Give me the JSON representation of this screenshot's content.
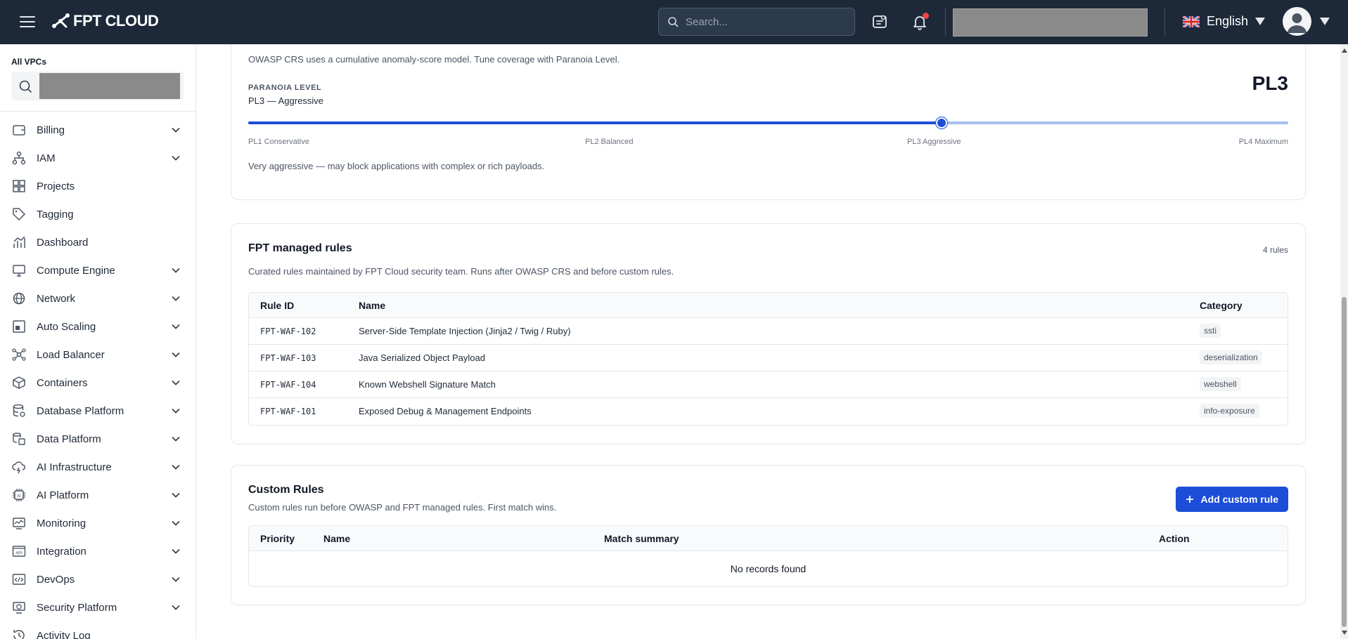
{
  "topbar": {
    "brand": "FPT CLOUD",
    "search_placeholder": "Search...",
    "language": "English"
  },
  "sidebar": {
    "vpc_label": "All VPCs",
    "items": [
      {
        "label": "Billing",
        "icon": "wallet-icon",
        "expandable": true
      },
      {
        "label": "IAM",
        "icon": "hierarchy-icon",
        "expandable": true
      },
      {
        "label": "Projects",
        "icon": "grid-plus-icon",
        "expandable": false
      },
      {
        "label": "Tagging",
        "icon": "tag-icon",
        "expandable": false
      },
      {
        "label": "Dashboard",
        "icon": "chart-icon",
        "expandable": false
      },
      {
        "label": "Compute Engine",
        "icon": "monitor-icon",
        "expandable": true
      },
      {
        "label": "Network",
        "icon": "globe-icon",
        "expandable": true
      },
      {
        "label": "Auto Scaling",
        "icon": "scaling-icon",
        "expandable": true
      },
      {
        "label": "Load Balancer",
        "icon": "load-balancer-icon",
        "expandable": true
      },
      {
        "label": "Containers",
        "icon": "cube-icon",
        "expandable": true
      },
      {
        "label": "Database Platform",
        "icon": "database-icon",
        "expandable": true
      },
      {
        "label": "Data Platform",
        "icon": "data-platform-icon",
        "expandable": true
      },
      {
        "label": "AI Infrastructure",
        "icon": "cloud-bolt-icon",
        "expandable": true
      },
      {
        "label": "AI Platform",
        "icon": "ai-chip-icon",
        "expandable": true
      },
      {
        "label": "Monitoring",
        "icon": "monitoring-icon",
        "expandable": true
      },
      {
        "label": "Integration",
        "icon": "api-icon",
        "expandable": true
      },
      {
        "label": "DevOps",
        "icon": "code-icon",
        "expandable": true
      },
      {
        "label": "Security Platform",
        "icon": "shield-icon",
        "expandable": true
      },
      {
        "label": "Activity Log",
        "icon": "history-icon",
        "expandable": false
      }
    ]
  },
  "owasp": {
    "description": "OWASP CRS uses a cumulative anomaly-score model. Tune coverage with Paranoia Level.",
    "paranoia_label": "PARANOIA LEVEL",
    "paranoia_value": "PL3 — Aggressive",
    "level_badge": "PL3",
    "slider_fraction": 0.667,
    "ticks": [
      "PL1 Conservative",
      "PL2 Balanced",
      "PL3 Aggressive",
      "PL4 Maximum"
    ],
    "note": "Very aggressive — may block applications with complex or rich payloads."
  },
  "managed": {
    "title": "FPT managed rules",
    "count": "4 rules",
    "description": "Curated rules maintained by FPT Cloud security team. Runs after OWASP CRS and before custom rules.",
    "columns": {
      "id": "Rule ID",
      "name": "Name",
      "category": "Category"
    },
    "rows": [
      {
        "id": "FPT-WAF-102",
        "name": "Server-Side Template Injection (Jinja2 / Twig / Ruby)",
        "category": "ssti"
      },
      {
        "id": "FPT-WAF-103",
        "name": "Java Serialized Object Payload",
        "category": "deserialization"
      },
      {
        "id": "FPT-WAF-104",
        "name": "Known Webshell Signature Match",
        "category": "webshell"
      },
      {
        "id": "FPT-WAF-101",
        "name": "Exposed Debug & Management Endpoints",
        "category": "info-exposure"
      }
    ]
  },
  "custom": {
    "title": "Custom Rules",
    "description": "Custom rules run before OWASP and FPT managed rules. First match wins.",
    "add_button": "Add custom rule",
    "columns": {
      "priority": "Priority",
      "name": "Name",
      "match": "Match summary",
      "action": "Action"
    },
    "empty": "No records found"
  },
  "colors": {
    "topbar": "#1d2939",
    "primary": "#1d4ed8",
    "slider_track": "#a9bff0"
  }
}
